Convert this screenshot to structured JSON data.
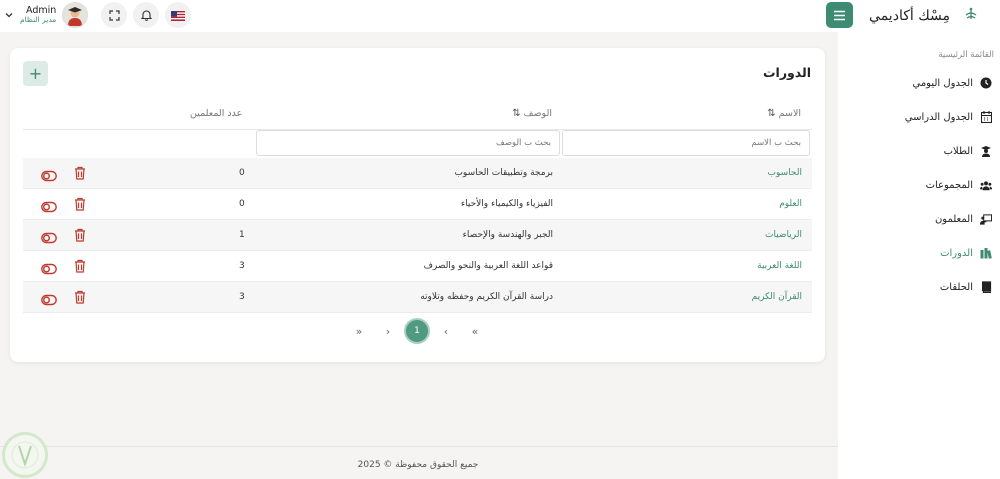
{
  "brand": {
    "name": "مِسْك أكاديمي",
    "logo_caption": "مسك أكاديمي"
  },
  "sidebar": {
    "section_title": "القائمة الرئيسية",
    "items": [
      {
        "label": "الجدول اليومي",
        "icon": "clock-icon"
      },
      {
        "label": "الجدول الدراسي",
        "icon": "calendar-icon"
      },
      {
        "label": "الطلاب",
        "icon": "graduate-icon"
      },
      {
        "label": "المجموعات",
        "icon": "users-icon"
      },
      {
        "label": "المعلمون",
        "icon": "chalkboard-teacher-icon"
      },
      {
        "label": "الدورات",
        "icon": "books-icon",
        "active": true
      },
      {
        "label": "الحلقات",
        "icon": "book-icon"
      }
    ]
  },
  "topbar": {
    "user_name": "Admin",
    "user_role": "مدير النظام",
    "language_flag": "us-flag-icon"
  },
  "card": {
    "title": "الدورات",
    "add_label": "+",
    "columns": {
      "name": "الاسم",
      "description": "الوصف",
      "teachers_count": "عدد المعلمين"
    },
    "filters": {
      "name_placeholder": "بحث ب الاسم",
      "description_placeholder": "بحث ب الوصف"
    },
    "rows": [
      {
        "name": "الحاسوب",
        "description": "برمجة وتطبيقات الحاسوب",
        "count": "0"
      },
      {
        "name": "العلوم",
        "description": "الفيزياء والكيمياء والأحياء",
        "count": "0"
      },
      {
        "name": "الرياضيات",
        "description": "الجبر والهندسة والإحصاء",
        "count": "1"
      },
      {
        "name": "اللغة العربية",
        "description": "قواعد اللغة العربية والنحو والصرف",
        "count": "3"
      },
      {
        "name": "القرآن الكريم",
        "description": "دراسة القرآن الكريم وحفظه وتلاوته",
        "count": "3"
      }
    ],
    "pagination": {
      "first": "«",
      "prev": "‹",
      "current": "1",
      "next": "›",
      "last": "»"
    }
  },
  "footer": {
    "text": "جميع الحقوق محفوظة © 2025"
  },
  "colors": {
    "accent": "#3d8b72",
    "delete": "#c0392b",
    "active_page": "#4f9a80"
  }
}
